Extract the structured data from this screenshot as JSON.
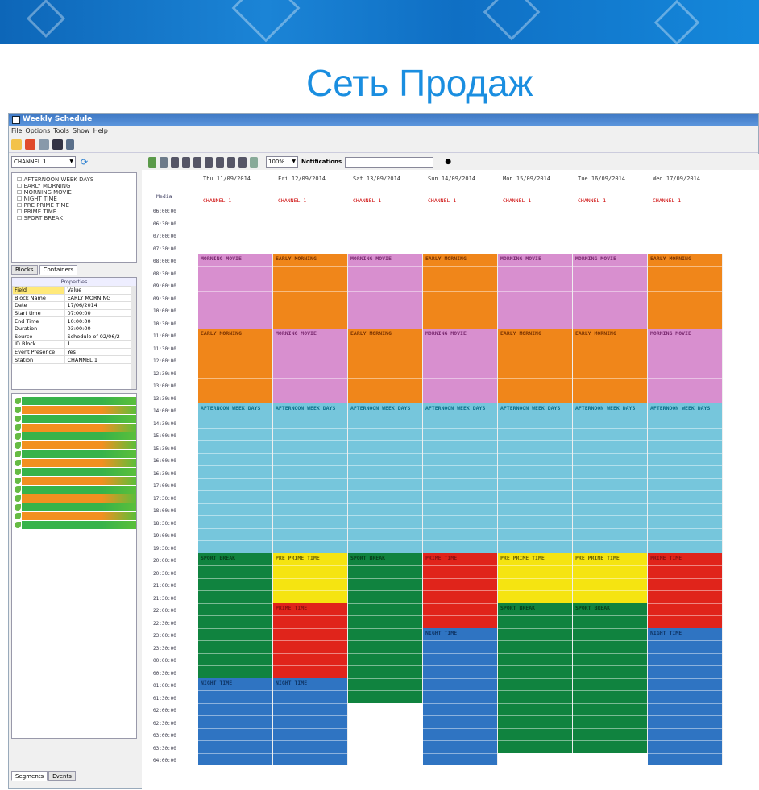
{
  "slide": {
    "title": "Сеть Продаж"
  },
  "window": {
    "title": "Weekly Schedule"
  },
  "menu": [
    "File",
    "Options",
    "Tools",
    "Show",
    "Help"
  ],
  "left": {
    "channel_select": "CHANNEL 1",
    "tree": [
      "AFTERNOON WEEK DAYS",
      "EARLY MORNING",
      "MORNING MOVIE",
      "NIGHT TIME",
      "PRE PRIME TIME",
      "PRIME TIME",
      "SPORT BREAK"
    ],
    "tabs": [
      "Blocks",
      "Containers"
    ],
    "properties_title": "Properties",
    "properties": [
      [
        "Field",
        "Value"
      ],
      [
        "Block Name",
        "EARLY MORNING"
      ],
      [
        "Date",
        "17/06/2014"
      ],
      [
        "Start time",
        "07:00:00"
      ],
      [
        "End Time",
        "10:00:00"
      ],
      [
        "Duration",
        "03:00:00"
      ],
      [
        "Source",
        "Schedule of 02/06/2"
      ],
      [
        "ID Block",
        "1"
      ],
      [
        "Event Presence",
        "Yes"
      ],
      [
        "Station",
        "CHANNEL 1"
      ]
    ],
    "bottom_tabs": [
      "Segments",
      "Events"
    ]
  },
  "toolbar2": {
    "zoom": "100%",
    "notif_label": "Notifications"
  },
  "grid": {
    "corner": "Media",
    "days": [
      "Thu 11/09/2014",
      "Fri 12/09/2014",
      "Sat 13/09/2014",
      "Sun 14/09/2014",
      "Mon 15/09/2014",
      "Tue 16/09/2014",
      "Wed 17/09/2014"
    ],
    "channel": "CHANNEL 1",
    "time_labels": [
      "06:00:00",
      "06:30:00",
      "07:00:00",
      "07:30:00",
      "08:00:00",
      "08:30:00",
      "09:00:00",
      "09:30:00",
      "10:00:00",
      "10:30:00",
      "11:00:00",
      "11:30:00",
      "12:00:00",
      "12:30:00",
      "13:00:00",
      "13:30:00",
      "14:00:00",
      "14:30:00",
      "15:00:00",
      "15:30:00",
      "16:00:00",
      "16:30:00",
      "17:00:00",
      "17:30:00",
      "18:00:00",
      "18:30:00",
      "19:00:00",
      "19:30:00",
      "20:00:00",
      "20:30:00",
      "21:00:00",
      "21:30:00",
      "22:00:00",
      "22:30:00",
      "23:00:00",
      "23:30:00",
      "00:00:00",
      "00:30:00",
      "01:00:00",
      "01:30:00",
      "02:00:00",
      "02:30:00",
      "03:00:00",
      "03:30:00",
      "04:00:00"
    ],
    "colors": {
      "pink": "#d88fcf",
      "orange": "#f0861a",
      "cyan": "#76c6dc",
      "green": "#10833f",
      "yellow": "#f5e411",
      "red": "#e0241b",
      "blue": "#2f74c2"
    },
    "blocks": [
      [
        {
          "label": "MORNING MOVIE",
          "color": "pink",
          "start": 7.5,
          "end": 10.5
        },
        {
          "label": "EARLY MORNING",
          "color": "orange",
          "start": 10.5,
          "end": 13.5
        },
        {
          "label": "AFTERNOON WEEK DAYS",
          "color": "cyan",
          "start": 13.5,
          "end": 19.5
        },
        {
          "label": "SPORT BREAK",
          "color": "green",
          "start": 19.5,
          "end": 24.5
        },
        {
          "label": "NIGHT TIME",
          "color": "blue",
          "start": 24.5,
          "end": 28
        }
      ],
      [
        {
          "label": "EARLY MORNING",
          "color": "orange",
          "start": 7.5,
          "end": 10.5
        },
        {
          "label": "MORNING MOVIE",
          "color": "pink",
          "start": 10.5,
          "end": 13.5
        },
        {
          "label": "AFTERNOON WEEK DAYS",
          "color": "cyan",
          "start": 13.5,
          "end": 19.5
        },
        {
          "label": "PRE PRIME TIME",
          "color": "yellow",
          "start": 19.5,
          "end": 21.5
        },
        {
          "label": "PRIME TIME",
          "color": "red",
          "start": 21.5,
          "end": 24.5
        },
        {
          "label": "NIGHT TIME",
          "color": "blue",
          "start": 24.5,
          "end": 28
        }
      ],
      [
        {
          "label": "MORNING MOVIE",
          "color": "pink",
          "start": 7.5,
          "end": 10.5
        },
        {
          "label": "EARLY MORNING",
          "color": "orange",
          "start": 10.5,
          "end": 13.5
        },
        {
          "label": "AFTERNOON WEEK DAYS",
          "color": "cyan",
          "start": 13.5,
          "end": 19.5
        },
        {
          "label": "SPORT BREAK",
          "color": "green",
          "start": 19.5,
          "end": 25.5
        }
      ],
      [
        {
          "label": "EARLY MORNING",
          "color": "orange",
          "start": 7.5,
          "end": 10.5
        },
        {
          "label": "MORNING MOVIE",
          "color": "pink",
          "start": 10.5,
          "end": 13.5
        },
        {
          "label": "AFTERNOON WEEK DAYS",
          "color": "cyan",
          "start": 13.5,
          "end": 19.5
        },
        {
          "label": "PRIME TIME",
          "color": "red",
          "start": 19.5,
          "end": 22.5
        },
        {
          "label": "NIGHT TIME",
          "color": "blue",
          "start": 22.5,
          "end": 28
        }
      ],
      [
        {
          "label": "MORNING MOVIE",
          "color": "pink",
          "start": 7.5,
          "end": 10.5
        },
        {
          "label": "EARLY MORNING",
          "color": "orange",
          "start": 10.5,
          "end": 13.5
        },
        {
          "label": "AFTERNOON WEEK DAYS",
          "color": "cyan",
          "start": 13.5,
          "end": 19.5
        },
        {
          "label": "PRE PRIME TIME",
          "color": "yellow",
          "start": 19.5,
          "end": 21.5
        },
        {
          "label": "SPORT BREAK",
          "color": "green",
          "start": 21.5,
          "end": 27.5
        }
      ],
      [
        {
          "label": "MORNING MOVIE",
          "color": "pink",
          "start": 7.5,
          "end": 10.5
        },
        {
          "label": "EARLY MORNING",
          "color": "orange",
          "start": 10.5,
          "end": 13.5
        },
        {
          "label": "AFTERNOON WEEK DAYS",
          "color": "cyan",
          "start": 13.5,
          "end": 19.5
        },
        {
          "label": "PRE PRIME TIME",
          "color": "yellow",
          "start": 19.5,
          "end": 21.5
        },
        {
          "label": "SPORT BREAK",
          "color": "green",
          "start": 21.5,
          "end": 27.5
        }
      ],
      [
        {
          "label": "EARLY MORNING",
          "color": "orange",
          "start": 7.5,
          "end": 10.5
        },
        {
          "label": "MORNING MOVIE",
          "color": "pink",
          "start": 10.5,
          "end": 13.5
        },
        {
          "label": "AFTERNOON WEEK DAYS",
          "color": "cyan",
          "start": 13.5,
          "end": 19.5
        },
        {
          "label": "PRIME TIME",
          "color": "red",
          "start": 19.5,
          "end": 22.5
        },
        {
          "label": "NIGHT TIME",
          "color": "blue",
          "start": 22.5,
          "end": 28
        }
      ]
    ]
  }
}
